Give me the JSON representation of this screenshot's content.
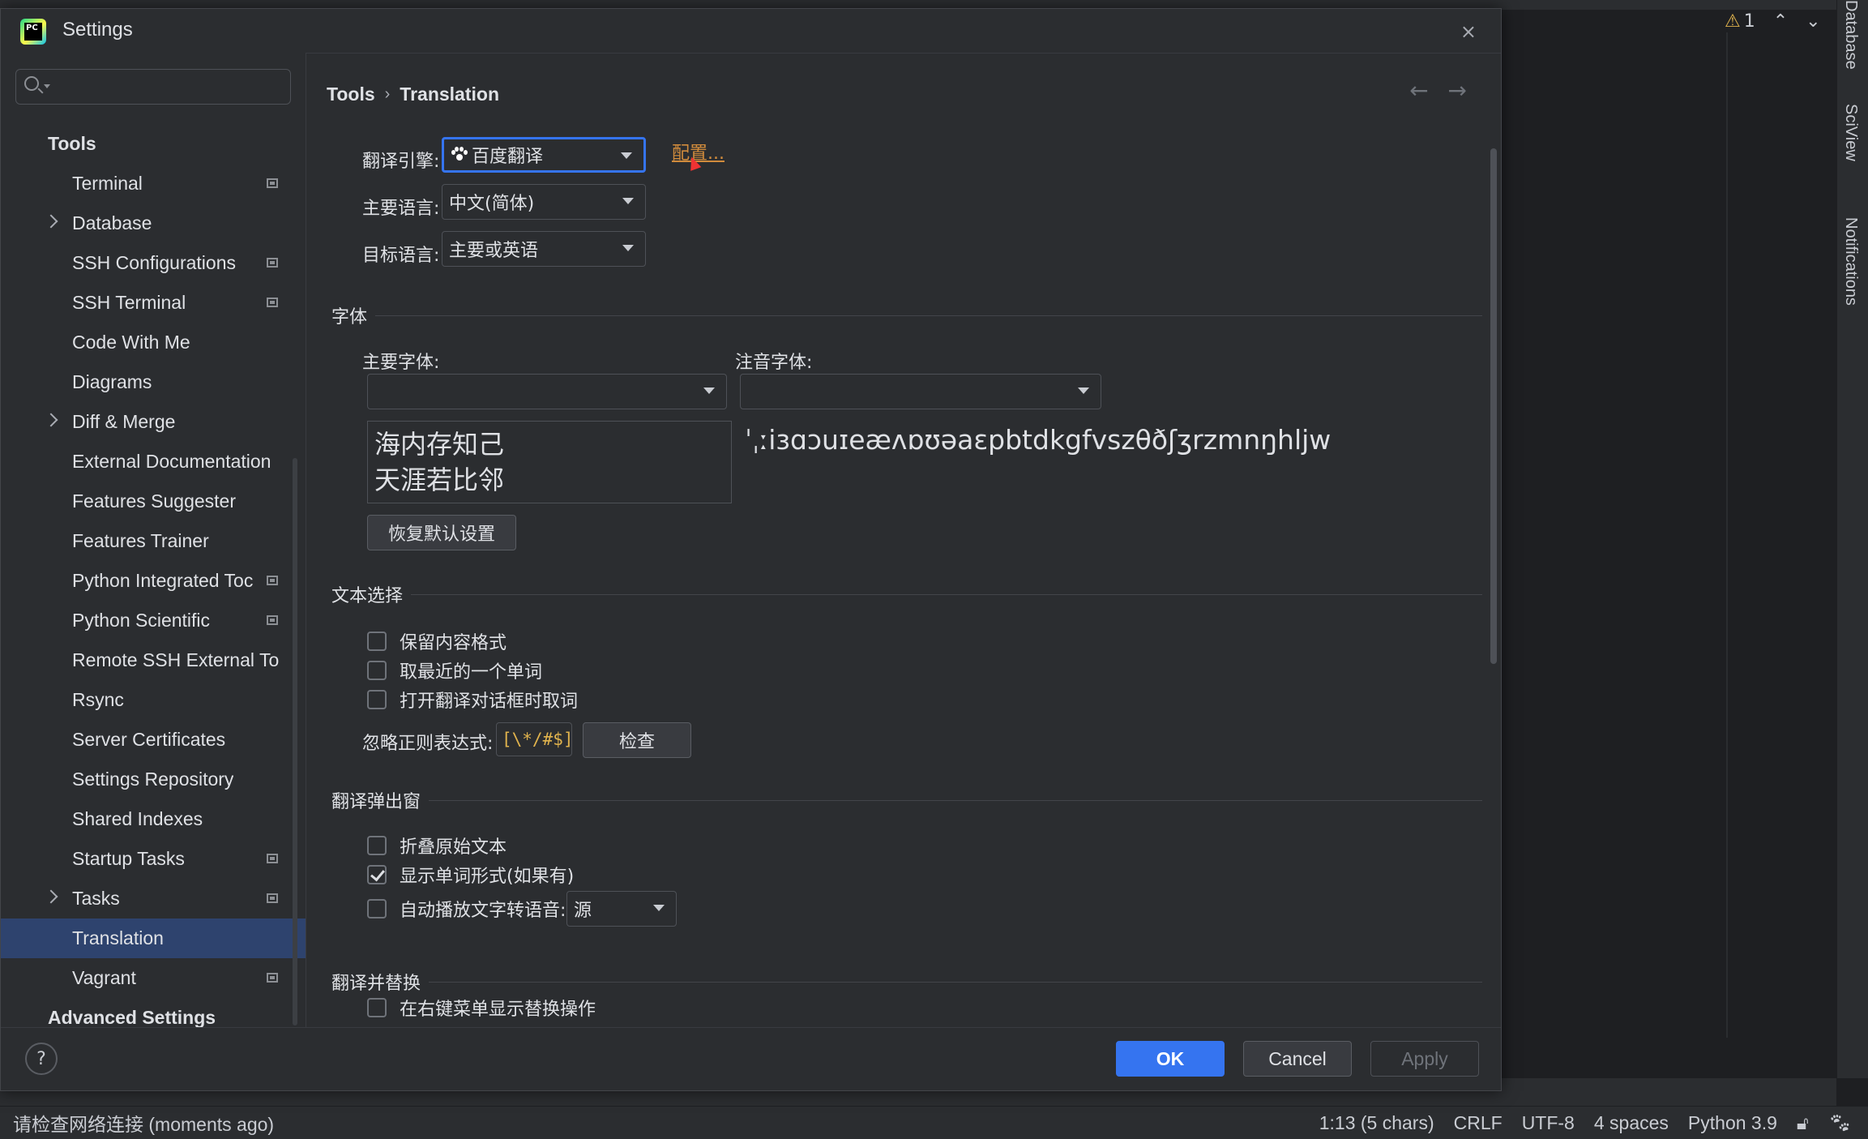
{
  "dialog": {
    "title": "Settings",
    "close_label": "×"
  },
  "ide": {
    "inspection_count": "1",
    "right_tools": [
      "Database",
      "SciView",
      "Notifications"
    ],
    "status": {
      "message": "请检查网络连接 (moments ago)",
      "position": "1:13 (5 chars)",
      "line_sep": "CRLF",
      "encoding": "UTF-8",
      "indent": "4 spaces",
      "interpreter": "Python 3.9"
    }
  },
  "sidebar": {
    "search_placeholder": "",
    "items": [
      {
        "label": "Tools",
        "kind": "header"
      },
      {
        "label": "Terminal",
        "kind": "child",
        "project": true
      },
      {
        "label": "Database",
        "kind": "child",
        "expandable": true
      },
      {
        "label": "SSH Configurations",
        "kind": "child",
        "project": true
      },
      {
        "label": "SSH Terminal",
        "kind": "child",
        "project": true
      },
      {
        "label": "Code With Me",
        "kind": "child"
      },
      {
        "label": "Diagrams",
        "kind": "child"
      },
      {
        "label": "Diff & Merge",
        "kind": "child",
        "expandable": true
      },
      {
        "label": "External Documentation",
        "kind": "child"
      },
      {
        "label": "Features Suggester",
        "kind": "child"
      },
      {
        "label": "Features Trainer",
        "kind": "child"
      },
      {
        "label": "Python Integrated Toc",
        "kind": "child",
        "project": true
      },
      {
        "label": "Python Scientific",
        "kind": "child",
        "project": true
      },
      {
        "label": "Remote SSH External To",
        "kind": "child"
      },
      {
        "label": "Rsync",
        "kind": "child"
      },
      {
        "label": "Server Certificates",
        "kind": "child"
      },
      {
        "label": "Settings Repository",
        "kind": "child"
      },
      {
        "label": "Shared Indexes",
        "kind": "child"
      },
      {
        "label": "Startup Tasks",
        "kind": "child",
        "project": true
      },
      {
        "label": "Tasks",
        "kind": "child",
        "expandable": true,
        "project": true
      },
      {
        "label": "Translation",
        "kind": "child",
        "selected": true
      },
      {
        "label": "Vagrant",
        "kind": "child",
        "project": true
      },
      {
        "label": "Advanced Settings",
        "kind": "header"
      }
    ]
  },
  "content": {
    "breadcrumb": {
      "parent": "Tools",
      "separator": "›",
      "current": "Translation"
    },
    "nav": {
      "back": "←",
      "forward": "→"
    },
    "engine": {
      "label": "翻译引擎:",
      "value": "百度翻译",
      "config_link": "配置..."
    },
    "primary_lang": {
      "label": "主要语言:",
      "value": "中文(简体)"
    },
    "target_lang": {
      "label": "目标语言:",
      "value": "主要或英语"
    },
    "font_section": {
      "title": "字体",
      "primary_font_label": "主要字体:",
      "phonetic_font_label": "注音字体:",
      "primary_font_value": "",
      "phonetic_font_value": "",
      "preview_line1": "海内存知己",
      "preview_line2": "天涯若比邻",
      "phonetic_preview": "ˈˌːiɜɑɔuɪeæʌɒʊəaɛpbtdkgfvszθðʃʒrzmnŋhljw",
      "restore_button": "恢复默认设置"
    },
    "text_selection": {
      "title": "文本选择",
      "options": [
        {
          "label": "保留内容格式",
          "checked": false
        },
        {
          "label": "取最近的一个单词",
          "checked": false
        },
        {
          "label": "打开翻译对话框时取词",
          "checked": false
        }
      ],
      "ignore_label": "忽略正则表达式:",
      "ignore_value": "[\\*/#$]",
      "check_button": "检查"
    },
    "popup": {
      "title": "翻译弹出窗",
      "options": [
        {
          "label": "折叠原始文本",
          "checked": false
        },
        {
          "label": "显示单词形式(如果有)",
          "checked": true
        },
        {
          "label": "自动播放文字转语音:",
          "checked": false
        }
      ],
      "tts_value": "源"
    },
    "replace": {
      "title": "翻译并替换",
      "options": [
        {
          "label": "在右键菜单显示替换操作",
          "checked": false
        }
      ]
    }
  },
  "footer": {
    "help": "?",
    "ok": "OK",
    "cancel": "Cancel",
    "apply": "Apply"
  }
}
